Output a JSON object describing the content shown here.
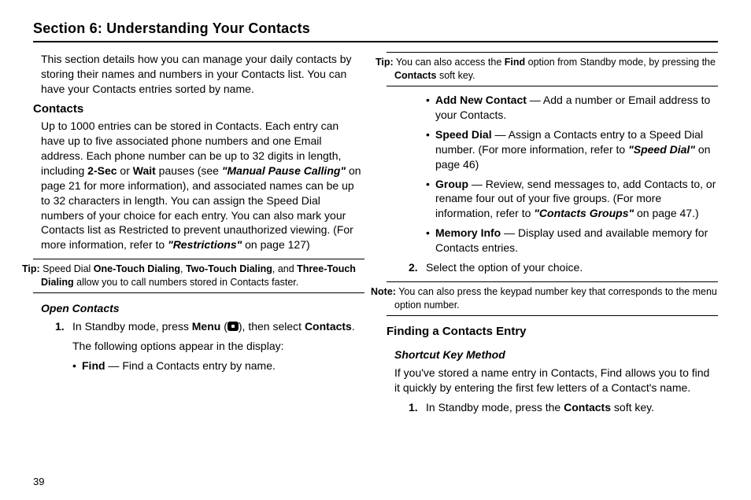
{
  "title": "Section 6: Understanding Your Contacts",
  "page_number": "39",
  "left": {
    "intro": "This section details how you can manage your daily contacts by storing their names and numbers in your Contacts list. You can have your Contacts entries sorted by name.",
    "contacts_heading": "Contacts",
    "contacts_p1_a": "Up to 1000 entries can be stored in Contacts. Each entry can have up to five associated phone numbers and one Email address. Each phone number can be up to 32 digits in length, including ",
    "contacts_p1_b": "2-Sec",
    "contacts_p1_c": " or ",
    "contacts_p1_d": "Wait",
    "contacts_p1_e": " pauses (see ",
    "contacts_p1_f": "\"Manual Pause Calling\"",
    "contacts_p1_g": " on page 21 for more information), and associated names can be up to 32 characters in length. You can assign the Speed Dial numbers of your choice for each entry. You can also mark your Contacts list as Restricted to prevent unauthorized viewing. (For more information, refer to ",
    "contacts_p1_h": "\"Restrictions\"",
    "contacts_p1_i": "  on page 127)",
    "tip1_label": "Tip:",
    "tip1_a": " Speed Dial ",
    "tip1_b": "One-Touch Dialing",
    "tip1_c": ", ",
    "tip1_d": "Two-Touch Dialing",
    "tip1_e": ", and ",
    "tip1_f": "Three-Touch Dialing",
    "tip1_g": " allow you to call numbers stored in Contacts faster.",
    "open_heading": "Open Contacts",
    "step1_num": "1.",
    "step1_a": "In Standby mode, press ",
    "step1_b": "Menu",
    "step1_c": " (",
    "step1_d": "), then select ",
    "step1_e": "Contacts",
    "step1_f": ".",
    "step1_follow": "The following options appear in the display:",
    "bullet_find_a": "Find",
    "bullet_find_b": " — Find a Contacts entry by name."
  },
  "right": {
    "tip2_label": "Tip:",
    "tip2_a": " You can also access the ",
    "tip2_b": "Find",
    "tip2_c": " option from Standby mode, by pressing the ",
    "tip2_d": "Contacts",
    "tip2_e": " soft key.",
    "b_add_a": "Add New Contact",
    "b_add_b": " — Add a number or Email address to your Contacts.",
    "b_speed_a": "Speed Dial",
    "b_speed_b": " — Assign a Contacts entry to a Speed Dial number. (For more information, refer to ",
    "b_speed_c": "\"Speed Dial\"",
    "b_speed_d": "  on page 46)",
    "b_group_a": "Group",
    "b_group_b": " — Review, send messages to, add Contacts to, or rename four out of your five groups. (For more information, refer to ",
    "b_group_c": "\"Contacts Groups\"",
    "b_group_d": "  on page 47.)",
    "b_mem_a": "Memory Info",
    "b_mem_b": " — Display used and available memory for Contacts entries.",
    "step2_num": "2.",
    "step2_text": "Select the option of your choice.",
    "note_label": "Note:",
    "note_text": " You can also press the keypad number key that corresponds to the menu option number.",
    "finding_heading": "Finding a Contacts Entry",
    "shortcut_heading": "Shortcut Key Method",
    "finding_p": "If you've stored a name entry in Contacts, Find allows you to find it quickly by entering the first few letters of a Contact's name.",
    "fstep1_num": "1.",
    "fstep1_a": "In Standby mode, press the ",
    "fstep1_b": "Contacts",
    "fstep1_c": " soft key."
  }
}
